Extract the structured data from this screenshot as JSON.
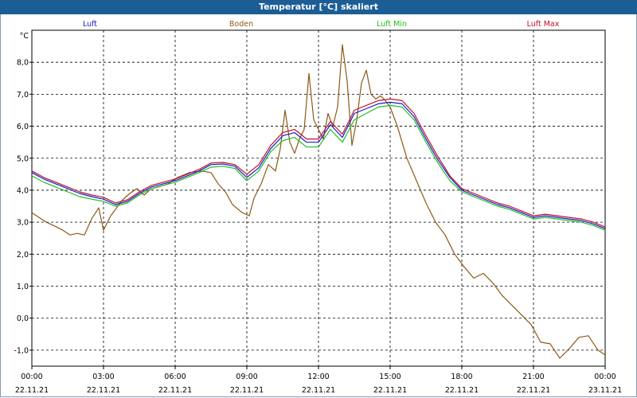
{
  "window": {
    "title": "Temperatur [°C] skaliert"
  },
  "colors": {
    "titlebar": "#1c5d96",
    "Luft": "#1a1acc",
    "Boden": "#8b5a14",
    "Luft Min": "#1fbf1f",
    "Luft Max": "#c0102a"
  },
  "chart_data": {
    "type": "line",
    "title": "Temperatur [°C] skaliert",
    "ylabel": "°C",
    "ylim": [
      -1.5,
      9.0
    ],
    "yticks": [
      -1.0,
      0.0,
      1.0,
      2.0,
      3.0,
      4.0,
      5.0,
      6.0,
      7.0,
      8.0
    ],
    "ytick_labels": [
      "-1,0",
      "0,0",
      "1,0",
      "2,0",
      "3,0",
      "4,0",
      "5,0",
      "6,0",
      "7,0",
      "8,0"
    ],
    "xlim": [
      0,
      24
    ],
    "xticks": [
      0,
      3,
      6,
      9,
      12,
      15,
      18,
      21,
      24
    ],
    "xtick_times": [
      "00:00",
      "03:00",
      "06:00",
      "09:00",
      "12:00",
      "15:00",
      "18:00",
      "21:00",
      "00:00"
    ],
    "xtick_dates": [
      "22.11.21",
      "22.11.21",
      "22.11.21",
      "22.11.21",
      "22.11.21",
      "22.11.21",
      "22.11.21",
      "22.11.21",
      "23.11.21"
    ],
    "grid": true,
    "legend_position": "top",
    "series": [
      {
        "name": "Luft",
        "x": [
          0,
          0.5,
          1,
          1.5,
          2,
          2.5,
          3,
          3.5,
          4,
          4.5,
          5,
          5.5,
          6,
          6.5,
          7,
          7.5,
          8,
          8.5,
          9,
          9.5,
          10,
          10.5,
          11,
          11.5,
          12,
          12.5,
          13,
          13.5,
          14,
          14.5,
          15,
          15.5,
          16,
          16.5,
          17,
          17.5,
          18,
          18.5,
          19,
          19.5,
          20,
          20.5,
          21,
          21.5,
          22,
          22.5,
          23,
          23.5,
          24
        ],
        "values": [
          4.55,
          4.35,
          4.2,
          4.05,
          3.9,
          3.8,
          3.72,
          3.55,
          3.65,
          3.9,
          4.1,
          4.2,
          4.3,
          4.45,
          4.6,
          4.8,
          4.82,
          4.75,
          4.4,
          4.7,
          5.3,
          5.7,
          5.8,
          5.5,
          5.5,
          6.05,
          5.65,
          6.4,
          6.55,
          6.7,
          6.75,
          6.7,
          6.3,
          5.6,
          4.95,
          4.4,
          4.0,
          3.85,
          3.7,
          3.55,
          3.45,
          3.3,
          3.15,
          3.2,
          3.15,
          3.1,
          3.05,
          2.95,
          2.8
        ]
      },
      {
        "name": "Boden",
        "x": [
          0,
          0.3,
          0.6,
          0.9,
          1.3,
          1.6,
          1.9,
          2.2,
          2.5,
          2.8,
          3.0,
          3.3,
          3.6,
          3.8,
          4.1,
          4.4,
          4.7,
          5.0,
          5.3,
          5.7,
          6.1,
          6.6,
          7.1,
          7.5,
          7.8,
          8.1,
          8.4,
          8.8,
          9.1,
          9.3,
          9.6,
          9.9,
          10.2,
          10.4,
          10.6,
          10.8,
          11.0,
          11.2,
          11.4,
          11.6,
          11.8,
          12.0,
          12.2,
          12.4,
          12.6,
          12.8,
          13.0,
          13.2,
          13.4,
          13.6,
          13.8,
          14.0,
          14.2,
          14.4,
          14.6,
          14.8,
          15.0,
          15.3,
          15.7,
          16.1,
          16.5,
          16.9,
          17.3,
          17.7,
          18.1,
          18.5,
          18.9,
          19.3,
          19.7,
          20.1,
          20.5,
          20.9,
          21.3,
          21.7,
          22.1,
          22.5,
          22.9,
          23.3,
          23.7,
          24
        ],
        "values": [
          3.3,
          3.15,
          3.0,
          2.9,
          2.75,
          2.6,
          2.65,
          2.6,
          3.1,
          3.45,
          2.75,
          3.2,
          3.5,
          3.7,
          3.9,
          4.05,
          3.85,
          4.05,
          4.1,
          4.2,
          4.4,
          4.55,
          4.6,
          4.55,
          4.2,
          3.95,
          3.55,
          3.3,
          3.2,
          3.75,
          4.2,
          4.8,
          4.6,
          5.3,
          6.5,
          5.5,
          5.15,
          5.6,
          5.9,
          7.65,
          6.2,
          5.9,
          5.6,
          6.4,
          6.0,
          6.6,
          8.55,
          7.4,
          5.4,
          6.2,
          7.35,
          7.75,
          7.0,
          6.85,
          6.95,
          6.8,
          6.6,
          6.0,
          5.0,
          4.3,
          3.6,
          3.0,
          2.6,
          2.0,
          1.6,
          1.25,
          1.4,
          1.1,
          0.7,
          0.4,
          0.1,
          -0.2,
          -0.75,
          -0.8,
          -1.25,
          -0.95,
          -0.6,
          -0.55,
          -1.0,
          -1.15
        ]
      },
      {
        "name": "Luft Min",
        "x": [
          0,
          0.5,
          1,
          1.5,
          2,
          2.5,
          3,
          3.5,
          4,
          4.5,
          5,
          5.5,
          6,
          6.5,
          7,
          7.5,
          8,
          8.5,
          9,
          9.5,
          10,
          10.5,
          11,
          11.5,
          12,
          12.5,
          13,
          13.5,
          14,
          14.5,
          15,
          15.5,
          16,
          16.5,
          17,
          17.5,
          18,
          18.5,
          19,
          19.5,
          20,
          20.5,
          21,
          21.5,
          22,
          22.5,
          23,
          23.5,
          24
        ],
        "values": [
          4.45,
          4.25,
          4.1,
          3.95,
          3.8,
          3.72,
          3.65,
          3.5,
          3.6,
          3.85,
          4.05,
          4.15,
          4.25,
          4.4,
          4.55,
          4.72,
          4.75,
          4.68,
          4.3,
          4.6,
          5.2,
          5.55,
          5.65,
          5.35,
          5.35,
          5.9,
          5.5,
          6.2,
          6.4,
          6.6,
          6.65,
          6.6,
          6.2,
          5.5,
          4.85,
          4.3,
          3.95,
          3.8,
          3.65,
          3.5,
          3.4,
          3.25,
          3.1,
          3.15,
          3.1,
          3.05,
          3.0,
          2.9,
          2.75
        ]
      },
      {
        "name": "Luft Max",
        "x": [
          0,
          0.5,
          1,
          1.5,
          2,
          2.5,
          3,
          3.5,
          4,
          4.5,
          5,
          5.5,
          6,
          6.5,
          7,
          7.5,
          8,
          8.5,
          9,
          9.5,
          10,
          10.5,
          11,
          11.5,
          12,
          12.5,
          13,
          13.5,
          14,
          14.5,
          15,
          15.5,
          16,
          16.5,
          17,
          17.5,
          18,
          18.5,
          19,
          19.5,
          20,
          20.5,
          21,
          21.5,
          22,
          22.5,
          23,
          23.5,
          24
        ],
        "values": [
          4.6,
          4.4,
          4.25,
          4.1,
          3.95,
          3.85,
          3.78,
          3.6,
          3.7,
          3.95,
          4.15,
          4.25,
          4.35,
          4.5,
          4.65,
          4.85,
          4.87,
          4.8,
          4.5,
          4.8,
          5.4,
          5.8,
          5.9,
          5.6,
          5.6,
          6.15,
          5.75,
          6.5,
          6.65,
          6.8,
          6.85,
          6.8,
          6.4,
          5.7,
          5.05,
          4.45,
          4.05,
          3.9,
          3.75,
          3.6,
          3.5,
          3.35,
          3.2,
          3.25,
          3.2,
          3.15,
          3.1,
          3.0,
          2.85
        ]
      }
    ]
  }
}
